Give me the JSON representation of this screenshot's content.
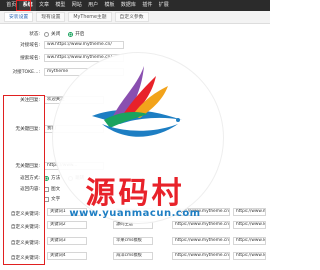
{
  "nav": {
    "items": [
      "首页",
      "系统",
      "文章",
      "模型",
      "网站",
      "用户",
      "模板",
      "数据库",
      "插件",
      "扩展"
    ],
    "active_index": 1
  },
  "subtabs": {
    "items": [
      "安装设置",
      "现有设置",
      "MyTheme主题",
      "自定义参数"
    ],
    "active_index": 0
  },
  "form": {
    "status": {
      "label": "状态:",
      "options": [
        "关闭",
        "开启"
      ],
      "selected": "开启"
    },
    "preview_domain": {
      "label": "对接域名:",
      "value": "ww.https://www.mytheme.cn/"
    },
    "backend_domain": {
      "label": "搜索域名:",
      "value": "ww.https://www.mytheme.cn/"
    },
    "token": {
      "label": "对接TOKE...:",
      "value": "mytheme"
    },
    "focus_keywords": {
      "label": "关注回复:",
      "value": "欢迎关注"
    },
    "no_keyword_reply": {
      "label": "无关键回复:",
      "value": "我们"
    },
    "no_keyword_reply2": {
      "label": "无关键回复:",
      "value": "https://www..."
    },
    "return_type": {
      "label": "返回方式:",
      "options": [
        "方法",
        "跳转"
      ],
      "selected": "方法"
    },
    "return_content": {
      "label": "返回内容:",
      "options": [
        "图文",
        "文字"
      ]
    }
  },
  "keyword_rows": [
    {
      "label": "自定义关键词:",
      "keyword": "关键词1",
      "title": "我的主题网",
      "url": "https://www.mytheme.cn/",
      "url2": "https://www.m..."
    },
    {
      "label": "自定义关键词:",
      "keyword": "关键词2",
      "title": "源码主题",
      "url": "https://www.mytheme.cn/",
      "url2": "https://www.ldd..."
    },
    {
      "label": "自定义关键词:",
      "keyword": "关键词3",
      "title": "苹果cms模板",
      "url": "https://www.mytheme.cn/",
      "url2": "https://www.ldd..."
    },
    {
      "label": "自定义关键词:",
      "keyword": "关键词4",
      "title": "海洋cms模板",
      "url": "https://www.mytheme.cn/",
      "url2": "https://www.ldd..."
    }
  ],
  "watermark": {
    "title": "源码村",
    "url": "www.yuanmacun.com"
  },
  "colors": {
    "nav_bg": "#2b2b2b",
    "highlight_red": "#e02020",
    "accent_green": "#1aa35e",
    "watermark_red": "#e8222a",
    "watermark_blue": "#1d7ec3"
  }
}
